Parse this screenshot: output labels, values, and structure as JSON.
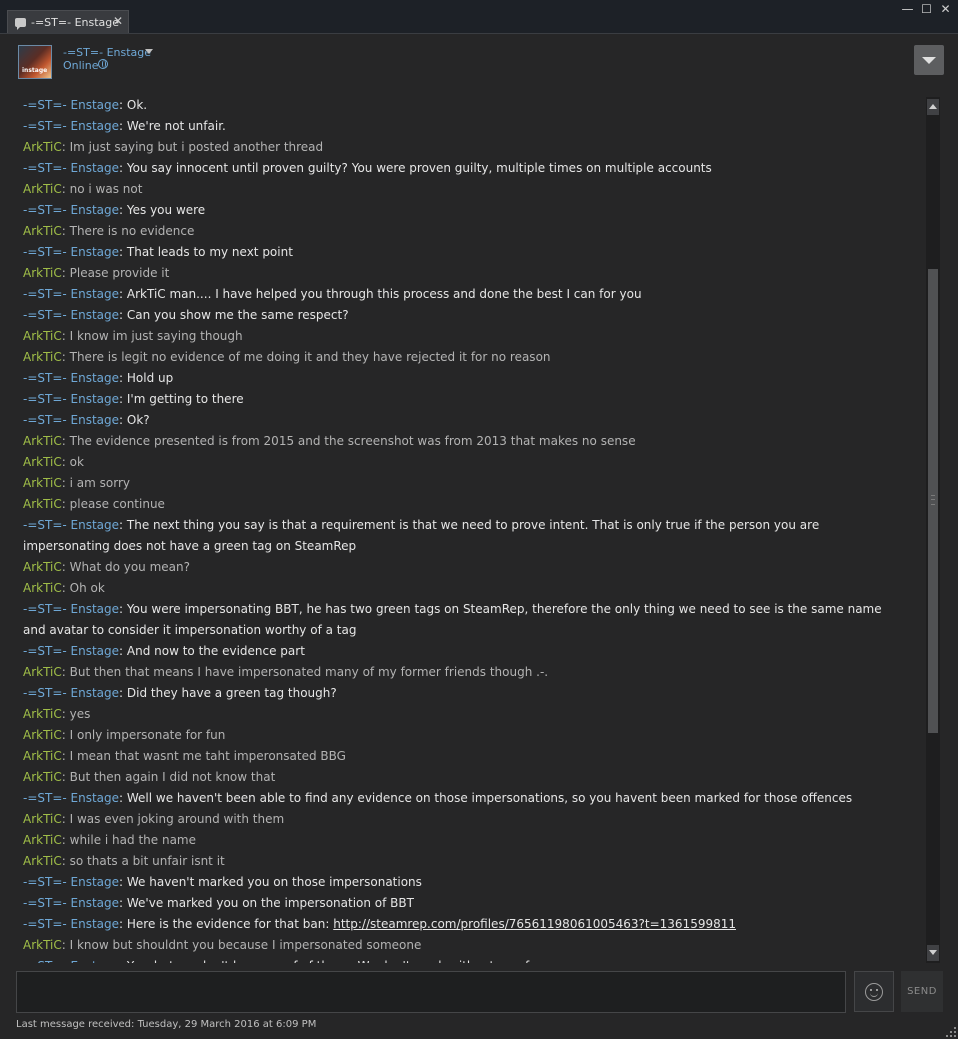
{
  "window": {
    "tab_title": "-=ST=- Enstage",
    "tab_close": "✕",
    "minimize": "—",
    "maximize": "☐",
    "close": "✕"
  },
  "header": {
    "friend_name": "-=ST=- Enstage",
    "status": "Online",
    "avatar_text": "instage"
  },
  "messages": [
    {
      "sender": "-=ST=- Enstage",
      "role": "st",
      "text": "Ok."
    },
    {
      "sender": "-=ST=- Enstage",
      "role": "st",
      "text": "We're not unfair."
    },
    {
      "sender": "ArkTiC",
      "role": "ark",
      "text": "Im just saying but i posted another thread"
    },
    {
      "sender": "-=ST=- Enstage",
      "role": "st",
      "text": "You say innocent until proven guilty? You were proven guilty, multiple times on multiple accounts"
    },
    {
      "sender": "ArkTiC",
      "role": "ark",
      "text": "no i was not"
    },
    {
      "sender": "-=ST=- Enstage",
      "role": "st",
      "text": "Yes you were"
    },
    {
      "sender": "ArkTiC",
      "role": "ark",
      "text": "There is no evidence"
    },
    {
      "sender": "-=ST=- Enstage",
      "role": "st",
      "text": "That leads to my next point"
    },
    {
      "sender": "ArkTiC",
      "role": "ark",
      "text": "Please provide it"
    },
    {
      "sender": "-=ST=- Enstage",
      "role": "st",
      "text": "ArkTiC man.... I have helped you through this process and done the best I can for you"
    },
    {
      "sender": "-=ST=- Enstage",
      "role": "st",
      "text": "Can you show me the same respect?"
    },
    {
      "sender": "ArkTiC",
      "role": "ark",
      "text": "I know im just saying though"
    },
    {
      "sender": "ArkTiC",
      "role": "ark",
      "text": "There is legit no evidence of me doing it and they have rejected it for no reason"
    },
    {
      "sender": "-=ST=- Enstage",
      "role": "st",
      "text": "Hold up"
    },
    {
      "sender": "-=ST=- Enstage",
      "role": "st",
      "text": "I'm getting to there"
    },
    {
      "sender": "-=ST=- Enstage",
      "role": "st",
      "text": "Ok?"
    },
    {
      "sender": "ArkTiC",
      "role": "ark",
      "text": "The evidence presented is from 2015 and the screenshot was from 2013 that makes no sense"
    },
    {
      "sender": "ArkTiC",
      "role": "ark",
      "text": "ok"
    },
    {
      "sender": "ArkTiC",
      "role": "ark",
      "text": "i am sorry"
    },
    {
      "sender": "ArkTiC",
      "role": "ark",
      "text": "please continue"
    },
    {
      "sender": "-=ST=- Enstage",
      "role": "st",
      "text": "The next thing you say is that a requirement is that we need to prove intent. That is only true if the person you are impersonating does not have a green tag on SteamRep"
    },
    {
      "sender": "ArkTiC",
      "role": "ark",
      "text": "What do you mean?"
    },
    {
      "sender": "ArkTiC",
      "role": "ark",
      "text": "Oh ok"
    },
    {
      "sender": "-=ST=- Enstage",
      "role": "st",
      "text": "You were impersonating BBT, he has two green tags on SteamRep, therefore the only thing we need to see is the same name and avatar to consider it impersonation worthy of a tag"
    },
    {
      "sender": "-=ST=- Enstage",
      "role": "st",
      "text": "And now to the evidence part"
    },
    {
      "sender": "ArkTiC",
      "role": "ark",
      "text": "But then that means I have impersonated many of my former friends though .-."
    },
    {
      "sender": "-=ST=- Enstage",
      "role": "st",
      "text": "Did they have a green tag though?"
    },
    {
      "sender": "ArkTiC",
      "role": "ark",
      "text": "yes"
    },
    {
      "sender": "ArkTiC",
      "role": "ark",
      "text": "I only impersonate for fun"
    },
    {
      "sender": "ArkTiC",
      "role": "ark",
      "text": "I mean that wasnt me taht imperonsated BBG"
    },
    {
      "sender": "ArkTiC",
      "role": "ark",
      "text": "But then again I did not know that"
    },
    {
      "sender": "-=ST=- Enstage",
      "role": "st",
      "text": "Well we haven't been able to find any evidence on those impersonations, so you havent been marked for those offences"
    },
    {
      "sender": "ArkTiC",
      "role": "ark",
      "text": "I was even joking around with them"
    },
    {
      "sender": "ArkTiC",
      "role": "ark",
      "text": "while i had the name"
    },
    {
      "sender": "ArkTiC",
      "role": "ark",
      "text": "so thats a bit unfair isnt it"
    },
    {
      "sender": "-=ST=- Enstage",
      "role": "st",
      "text": "We haven't marked you on those impersonations"
    },
    {
      "sender": "-=ST=- Enstage",
      "role": "st",
      "text": "We've marked you on the impersonation of BBT"
    },
    {
      "sender": "-=ST=- Enstage",
      "role": "st",
      "text": "Here is the evidence for that ban: ",
      "link": "http://steamrep.com/profiles/76561198061005463?t=1361599811"
    },
    {
      "sender": "ArkTiC",
      "role": "ark",
      "text": "I know but shouldnt you because I impersonated someone"
    },
    {
      "sender": "-=ST=- Enstage",
      "role": "st",
      "text": "Yes, but we don't have proof of those. We don't mark without proof"
    }
  ],
  "composer": {
    "send_label": "SEND",
    "last_message": "Last message received: Tuesday, 29 March 2016 at 6:09 PM"
  }
}
